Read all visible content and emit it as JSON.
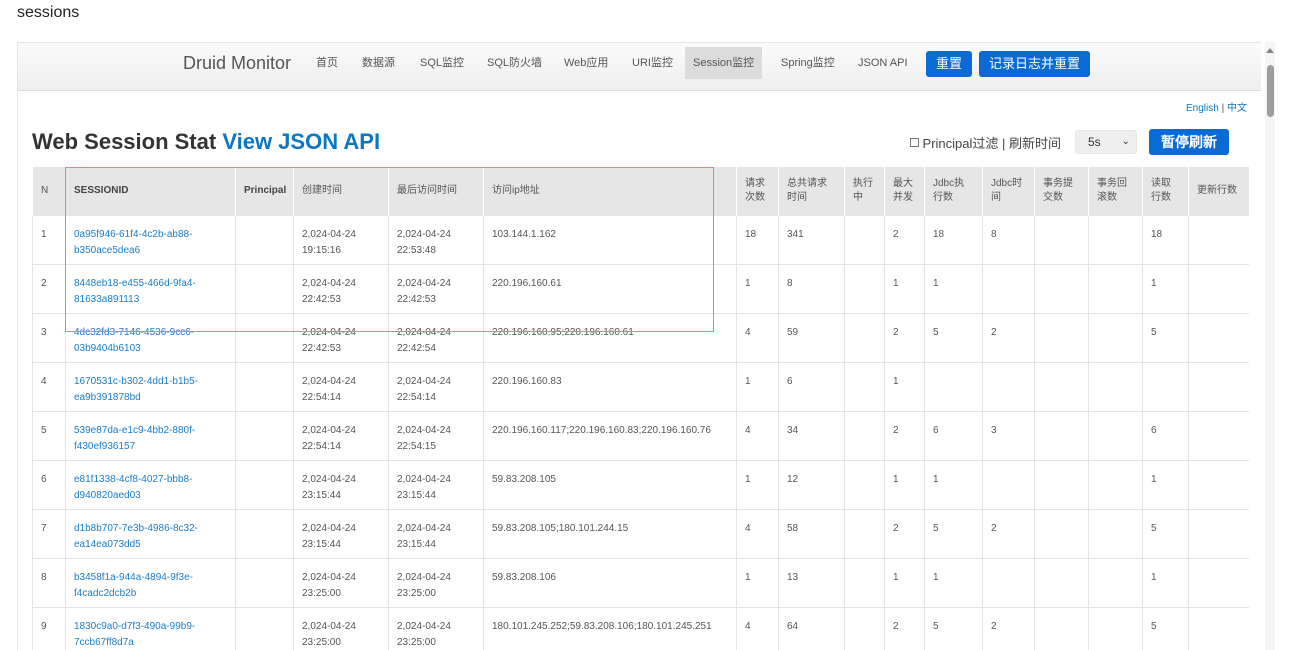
{
  "page": {
    "caption": "sessions"
  },
  "navbar": {
    "brand": "Druid Monitor",
    "items": [
      {
        "label": "首页"
      },
      {
        "label": "数据源"
      },
      {
        "label": "SQL监控"
      },
      {
        "label": "SQL防火墙"
      },
      {
        "label": "Web应用"
      },
      {
        "label": "URI监控"
      },
      {
        "label": "Session监控",
        "active": true
      },
      {
        "label": "Spring监控"
      },
      {
        "label": "JSON API"
      }
    ],
    "reset_label": "重置",
    "log_reset_label": "记录日志并重置"
  },
  "lang": {
    "english": "English",
    "separator": "|",
    "chinese": "中文"
  },
  "title": {
    "main": "Web Session Stat",
    "link": "View JSON API"
  },
  "controls": {
    "principal_filter": "Principal过滤 | 刷新时间",
    "refresh_value": "5s",
    "pause_label": "暂停刷新"
  },
  "table": {
    "headers": [
      "N",
      "SESSIONID",
      "Principal",
      "创建时间",
      "最后访问时间",
      "访问ip地址",
      "请求次数",
      "总共请求时间",
      "执行中",
      "最大并发",
      "Jdbc执行数",
      "Jdbc时间",
      "事务提交数",
      "事务回滚数",
      "读取行数",
      "更新行数"
    ],
    "rows": [
      [
        "1",
        "0a95f946-61f4-4c2b-ab88-b350ace5dea6",
        "",
        "2,024-04-24 19:15:16",
        "2,024-04-24 22:53:48",
        "103.144.1.162",
        "18",
        "341",
        "",
        "2",
        "18",
        "8",
        "",
        "",
        "18",
        ""
      ],
      [
        "2",
        "8448eb18-e455-466d-9fa4-81633a891113",
        "",
        "2,024-04-24 22:42:53",
        "2,024-04-24 22:42:53",
        "220.196.160.61",
        "1",
        "8",
        "",
        "1",
        "1",
        "",
        "",
        "",
        "1",
        ""
      ],
      [
        "3",
        "4dc32fd3-7146-4536-9cc6-03b9404b6103",
        "",
        "2,024-04-24 22:42:53",
        "2,024-04-24 22:42:54",
        "220.196.160.95;220.196.160.61",
        "4",
        "59",
        "",
        "2",
        "5",
        "2",
        "",
        "",
        "5",
        ""
      ],
      [
        "4",
        "1670531c-b302-4dd1-b1b5-ea9b391878bd",
        "",
        "2,024-04-24 22:54:14",
        "2,024-04-24 22:54:14",
        "220.196.160.83",
        "1",
        "6",
        "",
        "1",
        "",
        "",
        "",
        "",
        "",
        ""
      ],
      [
        "5",
        "539e87da-e1c9-4bb2-880f-f430ef936157",
        "",
        "2,024-04-24 22:54:14",
        "2,024-04-24 22:54:15",
        "220.196.160.117;220.196.160.83;220.196.160.76",
        "4",
        "34",
        "",
        "2",
        "6",
        "3",
        "",
        "",
        "6",
        ""
      ],
      [
        "6",
        "e81f1338-4cf8-4027-bbb8-d940820aed03",
        "",
        "2,024-04-24 23:15:44",
        "2,024-04-24 23:15:44",
        "59.83.208.105",
        "1",
        "12",
        "",
        "1",
        "1",
        "",
        "",
        "",
        "1",
        ""
      ],
      [
        "7",
        "d1b8b707-7e3b-4986-8c32-ea14ea073dd5",
        "",
        "2,024-04-24 23:15:44",
        "2,024-04-24 23:15:44",
        "59.83.208.105;180.101.244.15",
        "4",
        "58",
        "",
        "2",
        "5",
        "2",
        "",
        "",
        "5",
        ""
      ],
      [
        "8",
        "b3458f1a-944a-4894-9f3e-f4cadc2dcb2b",
        "",
        "2,024-04-24 23:25:00",
        "2,024-04-24 23:25:00",
        "59.83.208.106",
        "1",
        "13",
        "",
        "1",
        "1",
        "",
        "",
        "",
        "1",
        ""
      ],
      [
        "9",
        "1830c9a0-d7f3-490a-99b9-7ccb67ff8d7a",
        "",
        "2,024-04-24 23:25:00",
        "2,024-04-24 23:25:00",
        "180.101.245.252;59.83.208.106;180.101.245.251",
        "4",
        "64",
        "",
        "2",
        "5",
        "2",
        "",
        "",
        "5",
        ""
      ]
    ]
  },
  "colors": {
    "accent": "#0b6ad3",
    "link": "#0b77c5",
    "highlight": "#e48080"
  }
}
